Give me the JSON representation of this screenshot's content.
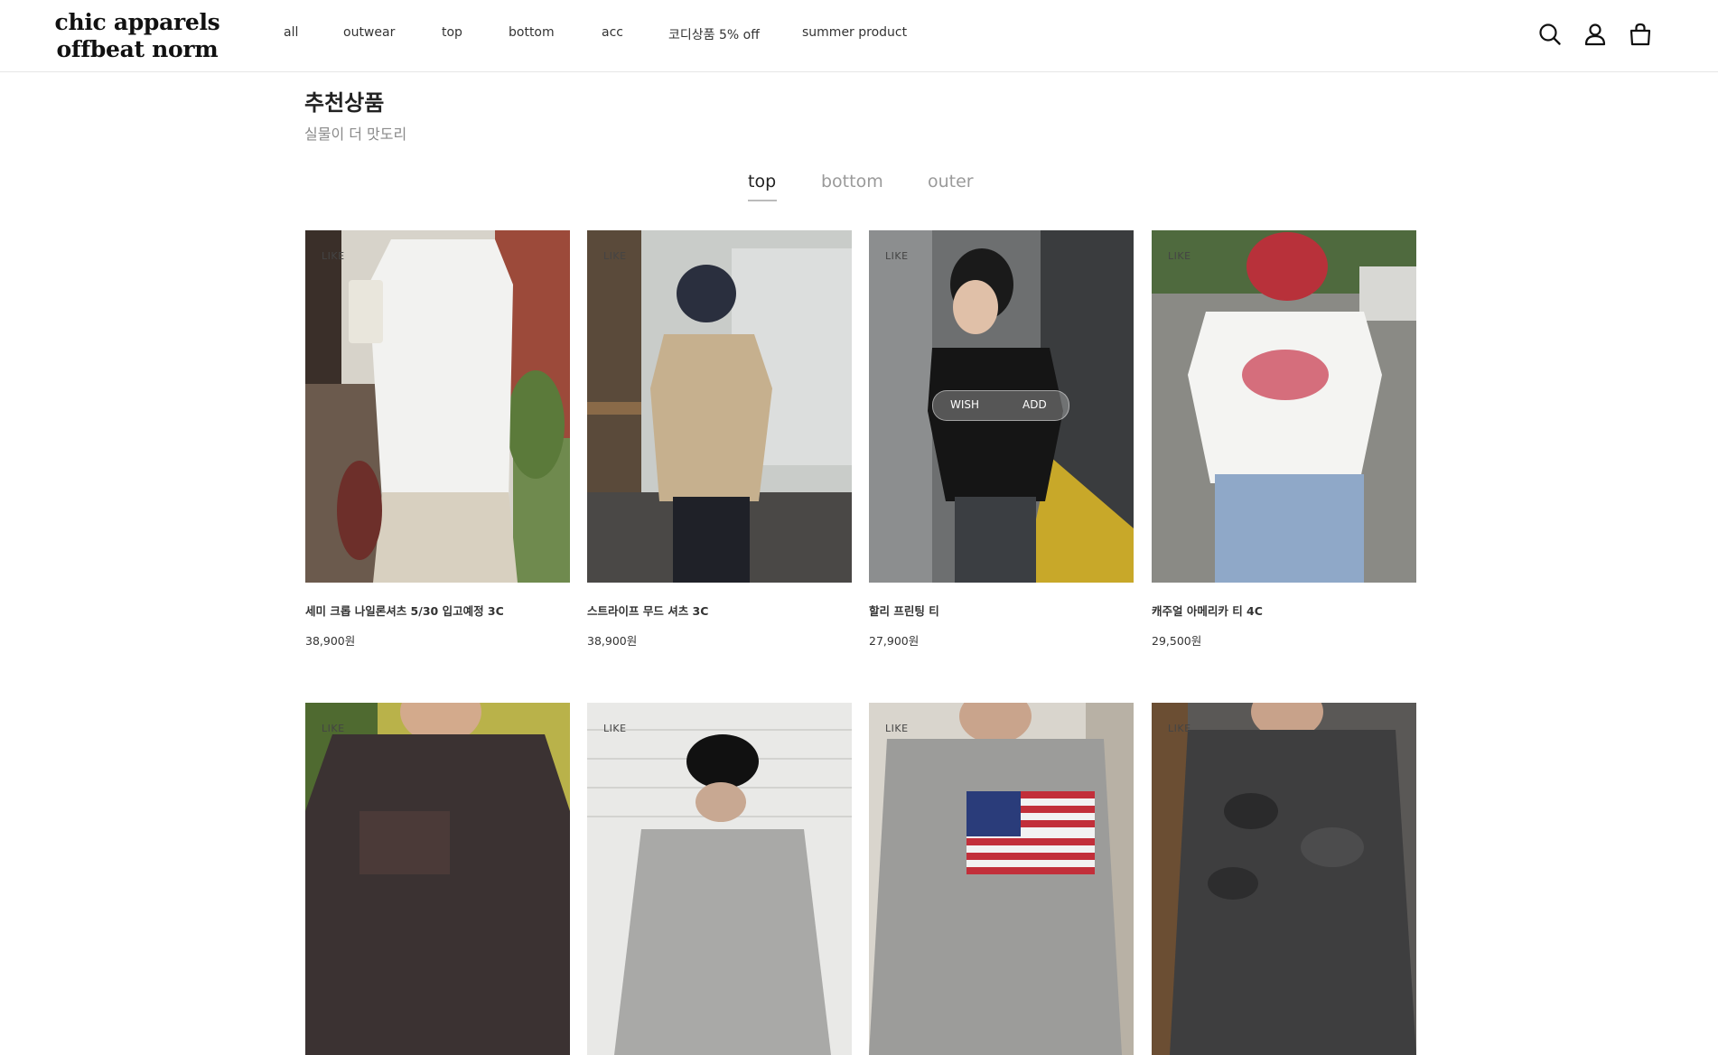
{
  "brand": {
    "logo_line1": "chic apparels",
    "logo_line2": "offbeat norm"
  },
  "nav": {
    "items": [
      {
        "label": "all"
      },
      {
        "label": "outwear"
      },
      {
        "label": "top"
      },
      {
        "label": "bottom"
      },
      {
        "label": "acc"
      },
      {
        "label": "코디상품 5% off"
      },
      {
        "label": "summer product"
      }
    ]
  },
  "header_icons": {
    "search": "search-icon",
    "account": "user-icon",
    "cart": "shopping-bag-icon"
  },
  "section": {
    "title": "추천상품",
    "subtitle": "실물이 더 맛도리"
  },
  "tabs": [
    {
      "label": "top",
      "active": true
    },
    {
      "label": "bottom",
      "active": false
    },
    {
      "label": "outer",
      "active": false
    }
  ],
  "like_label": "LIKE",
  "hover_actions": {
    "wish": "WISH",
    "add": "ADD"
  },
  "products_row1": [
    {
      "name": "세미 크롭 나일론셔츠 5/30 입고예정 3C",
      "price": "38,900원"
    },
    {
      "name": "스트라이프 무드 셔츠 3C",
      "price": "38,900원"
    },
    {
      "name": "할리 프린팅 티",
      "price": "27,900원"
    },
    {
      "name": "캐주얼 아메리카 티 4C",
      "price": "29,500원"
    }
  ],
  "products_row2": [
    {
      "name": "",
      "price": ""
    },
    {
      "name": "",
      "price": ""
    },
    {
      "name": "",
      "price": ""
    },
    {
      "name": "",
      "price": ""
    }
  ],
  "colors": {
    "text_dark": "#222222",
    "text_muted": "#8a8a8a",
    "tab_inactive": "#9a9a9a",
    "divider": "#e6e6e6"
  }
}
